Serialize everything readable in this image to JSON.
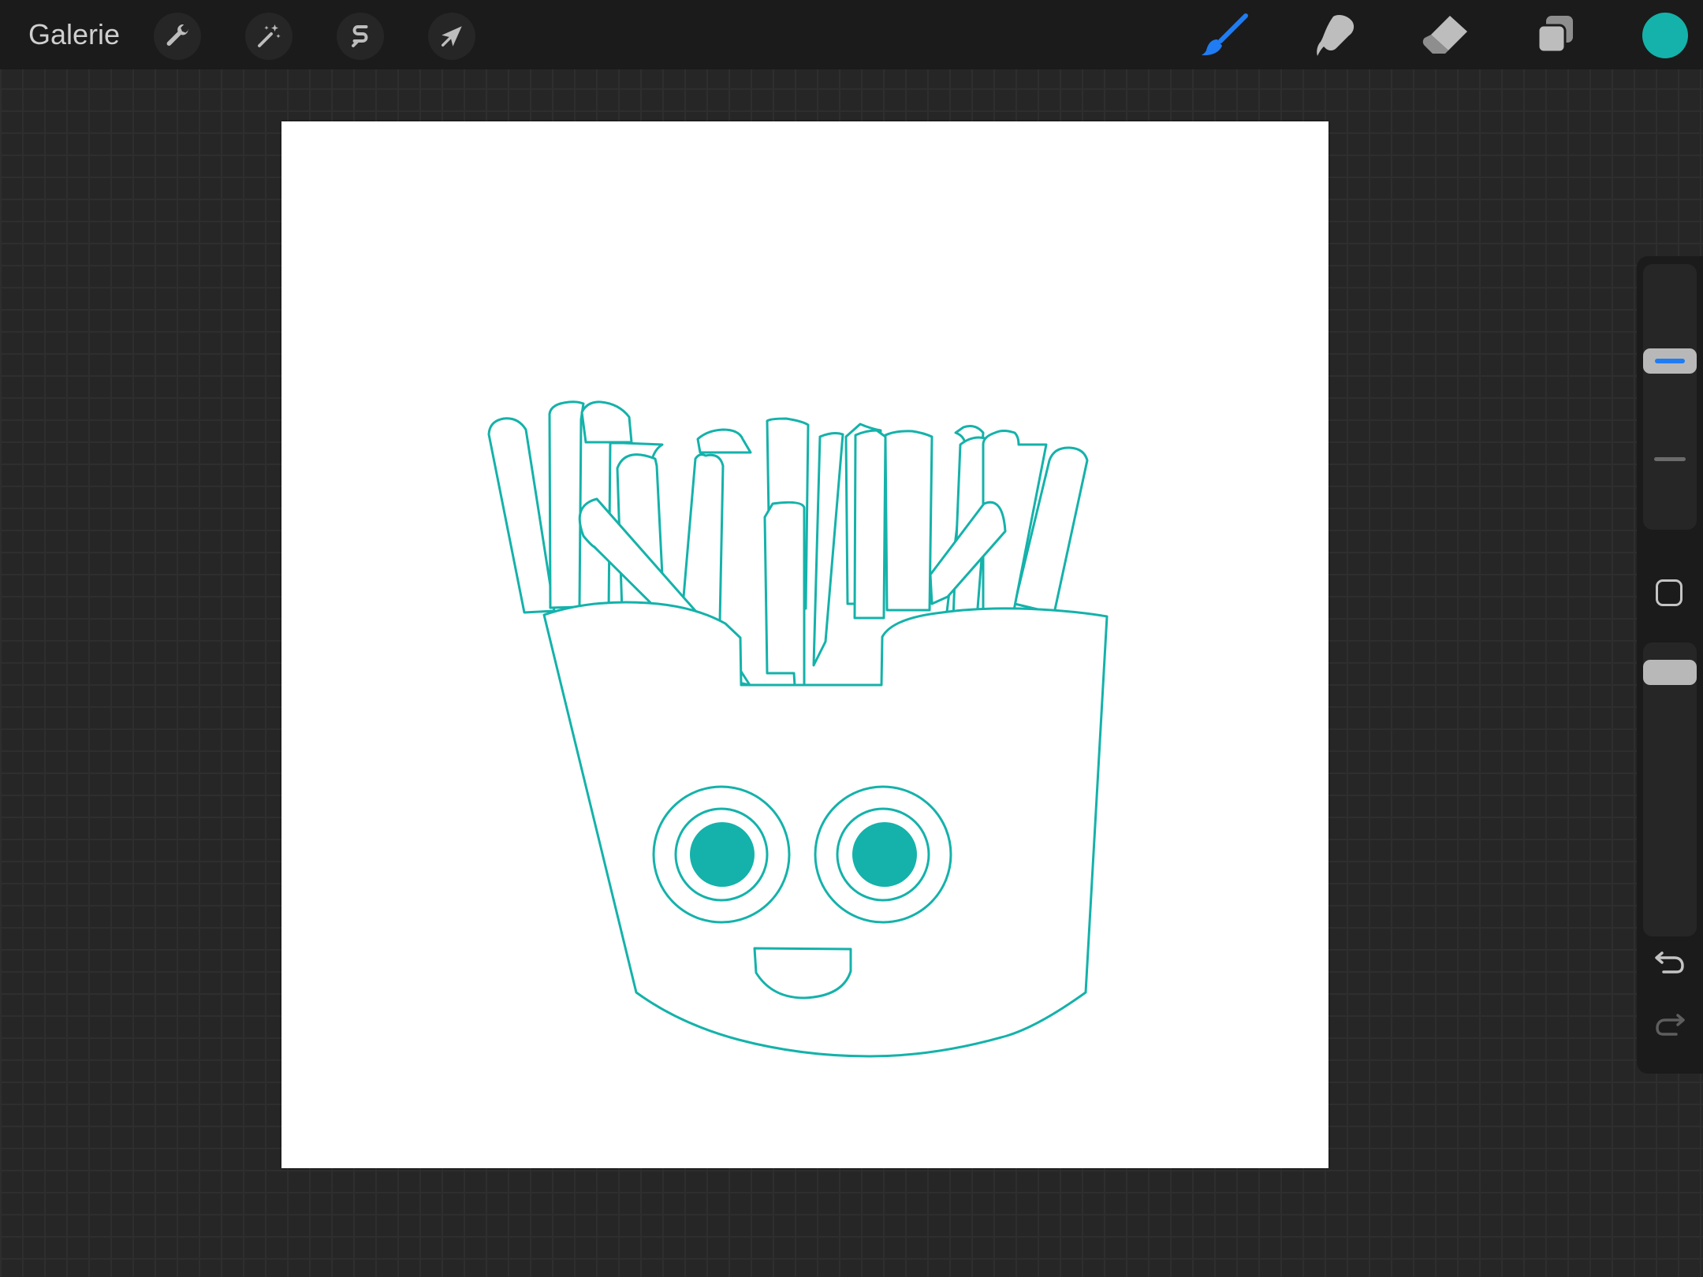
{
  "app": {
    "gallery_label": "Galerie",
    "accent_color": "#1f7cf2",
    "current_color": "#14b2aa",
    "active_tool": "brush"
  },
  "toolbar_left": [
    {
      "name": "actions",
      "icon": "wrench-icon"
    },
    {
      "name": "adjustments",
      "icon": "magic-wand-icon"
    },
    {
      "name": "selection",
      "icon": "selection-s-icon"
    },
    {
      "name": "transform",
      "icon": "arrow-cursor-icon"
    }
  ],
  "toolbar_right": [
    {
      "name": "brush",
      "icon": "brush-icon"
    },
    {
      "name": "smudge",
      "icon": "smudge-finger-icon"
    },
    {
      "name": "eraser",
      "icon": "eraser-icon"
    },
    {
      "name": "layers",
      "icon": "layers-icon"
    },
    {
      "name": "color",
      "icon": "color-swatch"
    }
  ],
  "sidebar": {
    "brush_size_icon": "size-slider",
    "modify_icon": "square-modify-icon",
    "opacity_icon": "opacity-slider",
    "undo_icon": "undo-arrow-icon",
    "redo_icon": "redo-arrow-icon"
  },
  "artwork": {
    "subject": "french-fries-character",
    "stroke_color": "#14b2aa",
    "pupil_color": "#14b2aa"
  }
}
